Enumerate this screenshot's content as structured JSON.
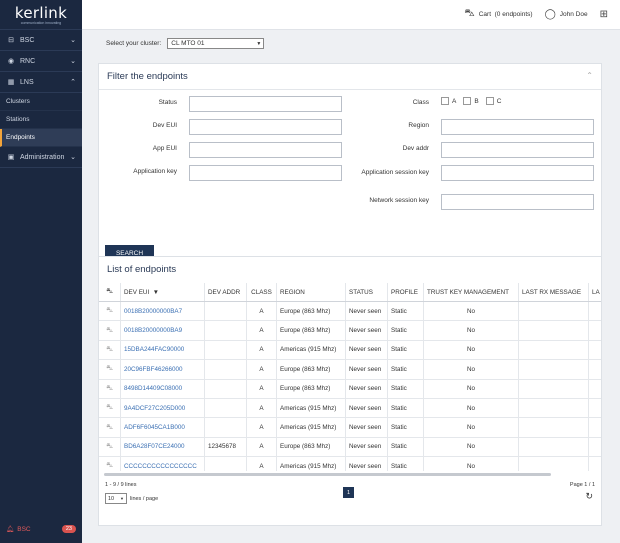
{
  "brand": {
    "name": "kerlink",
    "tagline": "communication innovating"
  },
  "sidebar": {
    "items": [
      {
        "label": "BSC",
        "icon": "tower-icon",
        "glyph": "⊟",
        "chevron": "⌄"
      },
      {
        "label": "RNC",
        "icon": "signal-icon",
        "glyph": "◉",
        "chevron": "⌄"
      },
      {
        "label": "LNS",
        "icon": "network-icon",
        "glyph": "▦",
        "chevron": "⌃"
      }
    ],
    "sub_items": [
      "Clusters",
      "Stations",
      "Endpoints"
    ],
    "admin": {
      "label": "Administration",
      "glyph": "▣",
      "chevron": "⌄"
    },
    "footer": {
      "label": "BSC",
      "badge": "23"
    }
  },
  "topbar": {
    "cart_label": "Cart",
    "cart_count": "(0 endpoints)",
    "user_name": "John Doe"
  },
  "cluster": {
    "label": "Select your cluster:",
    "selected": "CL MTO 01"
  },
  "filter": {
    "title": "Filter the endpoints",
    "labels": {
      "status": "Status",
      "dev_eui": "Dev EUI",
      "app_eui": "App EUI",
      "app_key": "Application key",
      "class": "Class",
      "region": "Region",
      "dev_addr": "Dev addr",
      "app_session_key": "Application session key",
      "nwk_session_key": "Network session key"
    },
    "class_options": [
      "A",
      "B",
      "C"
    ],
    "search_label": "SEARCH"
  },
  "list": {
    "title": "List of endpoints",
    "columns": [
      "DEV EUI",
      "DEV ADDR",
      "CLASS",
      "REGION",
      "STATUS",
      "PROFILE",
      "TRUST KEY MANAGEMENT",
      "LAST RX MESSAGE",
      "LA"
    ],
    "sort_indicator": "▼",
    "rows": [
      {
        "dev_eui": "0018B20000000BA7",
        "dev_addr": "",
        "class": "A",
        "region": "Europe (863 Mhz)",
        "status": "Never seen",
        "profile": "Static",
        "trust": "No",
        "last_rx": ""
      },
      {
        "dev_eui": "0018B20000000BA9",
        "dev_addr": "",
        "class": "A",
        "region": "Europe (863 Mhz)",
        "status": "Never seen",
        "profile": "Static",
        "trust": "No",
        "last_rx": ""
      },
      {
        "dev_eui": "15DBA244FAC90000",
        "dev_addr": "",
        "class": "A",
        "region": "Americas (915 Mhz)",
        "status": "Never seen",
        "profile": "Static",
        "trust": "No",
        "last_rx": ""
      },
      {
        "dev_eui": "20C96FBF46266000",
        "dev_addr": "",
        "class": "A",
        "region": "Europe (863 Mhz)",
        "status": "Never seen",
        "profile": "Static",
        "trust": "No",
        "last_rx": ""
      },
      {
        "dev_eui": "8498D14409C08000",
        "dev_addr": "",
        "class": "A",
        "region": "Europe (863 Mhz)",
        "status": "Never seen",
        "profile": "Static",
        "trust": "No",
        "last_rx": ""
      },
      {
        "dev_eui": "9A4DCF27C205D000",
        "dev_addr": "",
        "class": "A",
        "region": "Americas (915 Mhz)",
        "status": "Never seen",
        "profile": "Static",
        "trust": "No",
        "last_rx": ""
      },
      {
        "dev_eui": "ADF6F6045CA1B000",
        "dev_addr": "",
        "class": "A",
        "region": "Americas (915 Mhz)",
        "status": "Never seen",
        "profile": "Static",
        "trust": "No",
        "last_rx": ""
      },
      {
        "dev_eui": "BD6A28F07CE24000",
        "dev_addr": "12345678",
        "class": "A",
        "region": "Europe (863 Mhz)",
        "status": "Never seen",
        "profile": "Static",
        "trust": "No",
        "last_rx": ""
      },
      {
        "dev_eui": "CCCCCCCCCCCCCCCC",
        "dev_addr": "",
        "class": "A",
        "region": "Americas (915 Mhz)",
        "status": "Never seen",
        "profile": "Static",
        "trust": "No",
        "last_rx": ""
      }
    ],
    "footer": {
      "range": "1 - 9 / 9 lines",
      "lines_per_page": "10",
      "lines_label": "lines / page",
      "current_page": "1",
      "page_info": "Page 1 / 1"
    }
  }
}
